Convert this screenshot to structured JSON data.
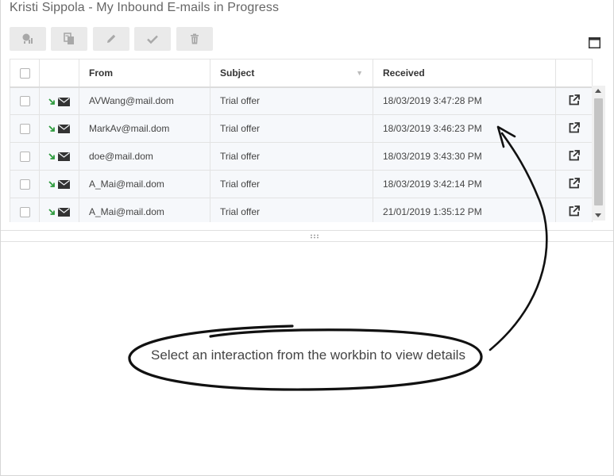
{
  "header": {
    "title": "Kristi Sippola - My Inbound E-mails in Progress"
  },
  "toolbar": {
    "buttons": [
      {
        "name": "mark-done-button",
        "icon": "done-chart-icon"
      },
      {
        "name": "move-button",
        "icon": "move-icon"
      },
      {
        "name": "edit-button",
        "icon": "pencil-icon"
      },
      {
        "name": "check-button",
        "icon": "check-icon"
      },
      {
        "name": "delete-button",
        "icon": "trash-icon"
      }
    ],
    "maximize_icon": "maximize-icon"
  },
  "grid": {
    "columns": {
      "from": "From",
      "subject": "Subject",
      "received": "Received"
    },
    "rows": [
      {
        "from": "AVWang@mail.dom",
        "subject": "Trial offer",
        "received": "18/03/2019 3:47:28 PM"
      },
      {
        "from": "MarkAv@mail.dom",
        "subject": "Trial offer",
        "received": "18/03/2019 3:46:23 PM"
      },
      {
        "from": "doe@mail.dom",
        "subject": "Trial offer",
        "received": "18/03/2019 3:43:30 PM"
      },
      {
        "from": "A_Mai@mail.dom",
        "subject": "Trial offer",
        "received": "18/03/2019 3:42:14 PM"
      },
      {
        "from": "A_Mai@mail.dom",
        "subject": "Trial offer",
        "received": "21/01/2019 1:35:12 PM"
      }
    ]
  },
  "details": {
    "message": "Select an interaction from the workbin to view details"
  },
  "colors": {
    "inbound_arrow": "#2e9b3e",
    "toolbar_bg": "#eaeaea",
    "row_bg": "#f6f8fb"
  }
}
